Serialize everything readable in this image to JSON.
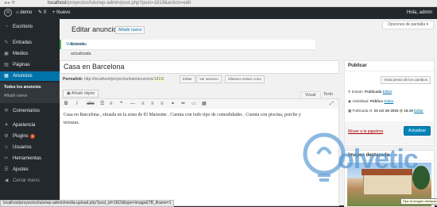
{
  "browser": {
    "url_host": "localhost",
    "url_path": "/proyectos/tuto/wp-admin/post.php?post=1819&action=edit"
  },
  "adminbar": {
    "wp_logo": "W",
    "site_name": "demo",
    "comments_count": "0",
    "new_label": "Nuevo",
    "greeting": "Hola, admin"
  },
  "sidebar": {
    "items": [
      {
        "icon": "dashboard-icon",
        "label": "Escritorio"
      },
      {
        "icon": "pushpin-icon",
        "label": "Entradas"
      },
      {
        "icon": "media-icon",
        "label": "Medios"
      },
      {
        "icon": "pages-icon",
        "label": "Páginas"
      },
      {
        "icon": "portfolio-icon",
        "label": "Anuncios"
      },
      {
        "icon": "comments-icon",
        "label": "Comentarios"
      },
      {
        "icon": "appearance-icon",
        "label": "Apariencia"
      },
      {
        "icon": "plugins-icon",
        "label": "Plugins",
        "badge": "3"
      },
      {
        "icon": "users-icon",
        "label": "Usuarios"
      },
      {
        "icon": "tools-icon",
        "label": "Herramientas"
      },
      {
        "icon": "settings-icon",
        "label": "Ajustes"
      },
      {
        "icon": "collapse-icon",
        "label": "Cerrar menú"
      }
    ],
    "submenu": [
      "Todos los anuncios",
      "Añadir nuevo"
    ]
  },
  "main": {
    "screen_options": "Opciones de pantalla",
    "page_title": "Editar anuncio",
    "add_new_button": "Añadir nuevo",
    "notice_text": "Entrada actualizada.",
    "notice_link": "Vista previa",
    "post_title": "Casa en Barcelona",
    "permalink_label": "Permalink:",
    "permalink_base": "http://localhost/proyectos/tuto/anuncios/",
    "permalink_slug": "1819",
    "edit_button": "Editar",
    "view_button": "Ver anuncio",
    "shortlink_button": "Obtener enlace corto",
    "add_media_button": "Añadir objeto",
    "tab_visual": "Visual",
    "tab_text": "Texto",
    "content": "Casa en Barcelona , situada en la zona de El Maresme . Cuenta con todo tipo de comodidades  . Cuenta con piscina, porche y terrazas."
  },
  "publish": {
    "title": "Publicar",
    "preview_button": "Vista previa de los cambios",
    "status_label": "Estado:",
    "status_value": "Publicada",
    "visibility_label": "Visibilidad:",
    "visibility_value": "Público",
    "published_label": "Publicada el:",
    "published_value": "23 oct de 2015 @ 15:19",
    "edit_link": "Editar",
    "trash_link": "Mover a la papelera",
    "update_button": "Actualizar"
  },
  "featured": {
    "title": "Imagen destacada",
    "tooltip": "Fijar la imagen destacada"
  },
  "watermark": "olvetic",
  "statusbar_url": "localhost/proyectos/tuto/wp-admin/media-upload.php?post_id=1819&type=image&TB_iframe=1"
}
